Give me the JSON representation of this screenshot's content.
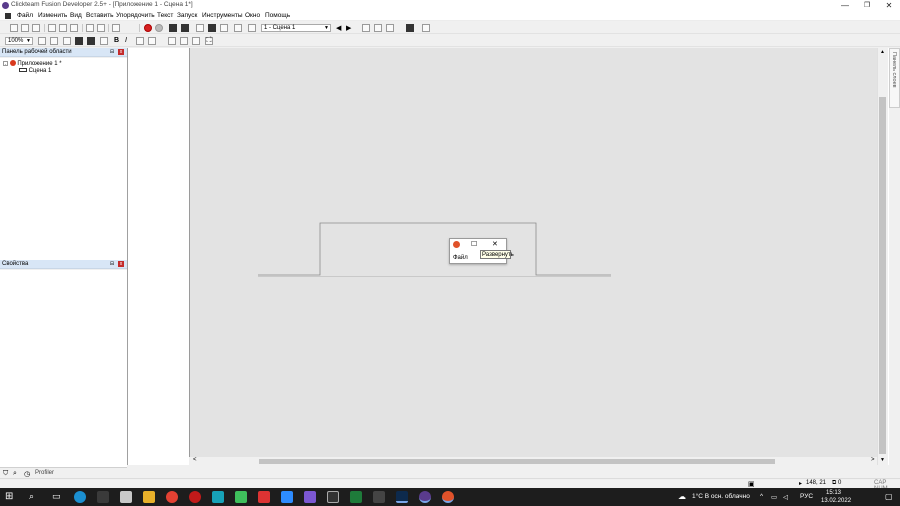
{
  "window": {
    "title": "Clickteam Fusion Developer 2.5+ - [Приложение 1 - Сцена 1*]",
    "controls": {
      "minimize": "—",
      "maximize": "❐",
      "close": "✕"
    }
  },
  "menubar": {
    "items": [
      "Файл",
      "Изменить",
      "Вид",
      "Вставить",
      "Упорядочить",
      "Текст",
      "Запуск",
      "Инструменты",
      "Окно",
      "Помощь"
    ]
  },
  "toolbar": {
    "frame_select": "1 - Сцена 1",
    "zoom": "100%"
  },
  "workspace_panel": {
    "title": "Панель рабочей области",
    "pin": "⊟",
    "close": "x",
    "tree": [
      {
        "label": "Приложение 1 *",
        "level": 0
      },
      {
        "label": "Сцена 1",
        "level": 1
      }
    ]
  },
  "properties_panel": {
    "title": "Свойства",
    "pin": "⊟",
    "close": "x"
  },
  "layers_tab": {
    "label": "Панель слоев"
  },
  "bottom_tabs": {
    "profiler": "Profiler"
  },
  "statusbar": {
    "coords": "148, 21",
    "layer": "0",
    "keys": "CAP NUM"
  },
  "mini_window": {
    "menu": "Файл",
    "max_symbol": "☐",
    "close_symbol": "✕",
    "tooltip": "Развернуть"
  },
  "taskbar": {
    "weather": "1°C  В осн. облачно",
    "lang": "РУС",
    "time": "15:13",
    "date": "13.02.2022"
  },
  "colors": {
    "panel_header": "#d8e6f6",
    "workarea": "#e3e3e3",
    "taskbar": "#1d1d1d",
    "close_red": "#c42b2b"
  }
}
